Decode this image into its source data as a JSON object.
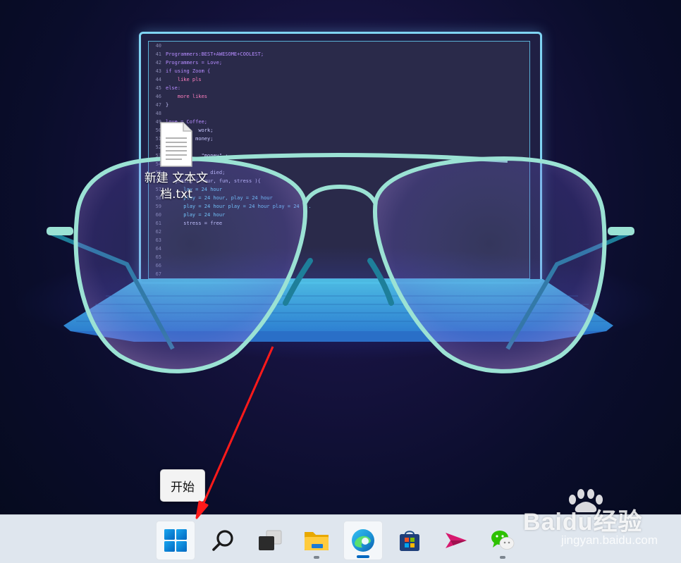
{
  "desktop": {
    "file_name": "新建 文本文档.txt",
    "file_name_line1": "新建 文本文",
    "file_name_line2": "档.txt"
  },
  "wallpaper_code": [
    {
      "n": "40",
      "t": ""
    },
    {
      "n": "41",
      "t": "Programmers:BEST+AWESOME+COOLEST;"
    },
    {
      "n": "42",
      "t": "Programmers = Love;"
    },
    {
      "n": "43",
      "t": "if using Zoom {"
    },
    {
      "n": "44",
      "t": "    like pls"
    },
    {
      "n": "45",
      "t": "else:"
    },
    {
      "n": "46",
      "t": "    more likes"
    },
    {
      "n": "47",
      "t": "}"
    },
    {
      "n": "48",
      "t": ""
    },
    {
      "n": "49",
      "t": "love = Coffee;"
    },
    {
      "n": "50",
      "t": "           work;"
    },
    {
      "n": "51",
      "t": "          money;"
    },
    {
      "n": "52",
      "t": ""
    },
    {
      "n": "53",
      "t": "            \"money\" :"
    },
    {
      "n": "54",
      "t": ""
    },
    {
      "n": "55",
      "t": "   ...     ... died;"
    },
    {
      "n": "56",
      "t": "   gaming ( hour, fun, stress ){"
    },
    {
      "n": "57",
      "t": "      lay = 24 hour"
    },
    {
      "n": "58",
      "t": "      play = 24 hour, play = 24 hour"
    },
    {
      "n": "59",
      "t": "      play = 24 hour play = 24 hour play = 24 ..."
    },
    {
      "n": "60",
      "t": "      play = 24 hour"
    },
    {
      "n": "61",
      "t": "      stress = free"
    },
    {
      "n": "62",
      "t": ""
    },
    {
      "n": "63",
      "t": ""
    },
    {
      "n": "64",
      "t": ""
    },
    {
      "n": "65",
      "t": ""
    },
    {
      "n": "66",
      "t": ""
    },
    {
      "n": "67",
      "t": ""
    }
  ],
  "tooltip": {
    "label": "开始"
  },
  "taskbar": {
    "items": [
      {
        "name": "start",
        "active": true
      },
      {
        "name": "search"
      },
      {
        "name": "task-view"
      },
      {
        "name": "file-explorer",
        "running": true
      },
      {
        "name": "edge",
        "active": true,
        "focused": true
      },
      {
        "name": "microsoft-store"
      },
      {
        "name": "send-app"
      },
      {
        "name": "wechat",
        "running": true
      }
    ]
  },
  "watermark": {
    "brand": "Baidu经验",
    "url": "jingyan.baidu.com"
  },
  "colors": {
    "taskbar_bg": "#dfe6ee",
    "win_blue": "#0078d4",
    "arrow_red": "#ff1a1a",
    "glasses_frame": "#8fd8c6"
  }
}
